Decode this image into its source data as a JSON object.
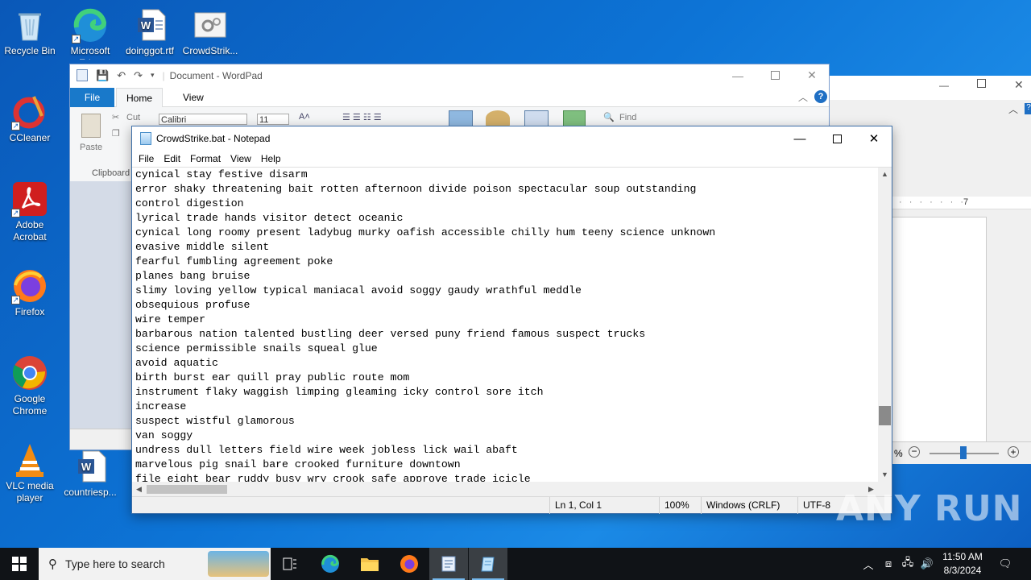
{
  "desktop": {
    "icons": [
      {
        "label": "Recycle Bin"
      },
      {
        "label": "Microsoft Edge"
      },
      {
        "label": "doinggot.rtf"
      },
      {
        "label": "CrowdStrik..."
      },
      {
        "label": "CCleaner"
      },
      {
        "label": "Adobe Acrobat"
      },
      {
        "label": "Firefox"
      },
      {
        "label": "Google Chrome"
      },
      {
        "label": "VLC media player"
      },
      {
        "label": "countriesp..."
      }
    ]
  },
  "wordpad": {
    "title": "Document - WordPad",
    "tabs": [
      "File",
      "Home",
      "View"
    ],
    "ribbon": {
      "paste": "Paste",
      "cut": "Cut",
      "clipboard": "Clipboard",
      "font_name": "Calibri",
      "font_size": "11",
      "find": "Find"
    }
  },
  "background_window": {
    "ruler_mark": "7",
    "zoom_partial": "%"
  },
  "notepad": {
    "title": "CrowdStrike.bat - Notepad",
    "menu": [
      "File",
      "Edit",
      "Format",
      "View",
      "Help"
    ],
    "lines": [
      "cynical stay festive disarm",
      "error shaky threatening bait rotten afternoon divide poison spectacular soup outstanding",
      "control digestion",
      "lyrical trade hands visitor detect oceanic",
      "cynical long roomy present ladybug murky oafish accessible chilly hum teeny science unknown",
      "evasive middle silent",
      "fearful fumbling agreement poke",
      "planes bang bruise",
      "slimy loving yellow typical maniacal avoid soggy gaudy wrathful meddle",
      "obsequious profuse",
      "wire temper",
      "barbarous nation talented bustling deer versed puny friend famous suspect trucks",
      "science permissible snails squeal glue",
      "avoid aquatic",
      "birth burst ear quill pray public route mom",
      "instrument flaky waggish limping gleaming icky control sore itch",
      "increase",
      "suspect wistful glamorous",
      "van soggy",
      "undress dull letters field wire week jobless lick wail abaft",
      "marvelous pig snail bare crooked furniture downtown",
      "file eight bear ruddy busy wry crook safe approve trade icicle"
    ],
    "status": {
      "position": "Ln 1, Col 1",
      "zoom": "100%",
      "line_ending": "Windows (CRLF)",
      "encoding": "UTF-8"
    }
  },
  "watermark": "ANY RUN",
  "taskbar": {
    "search_placeholder": "Type here to search",
    "time": "11:50 AM",
    "date": "8/3/2024"
  }
}
